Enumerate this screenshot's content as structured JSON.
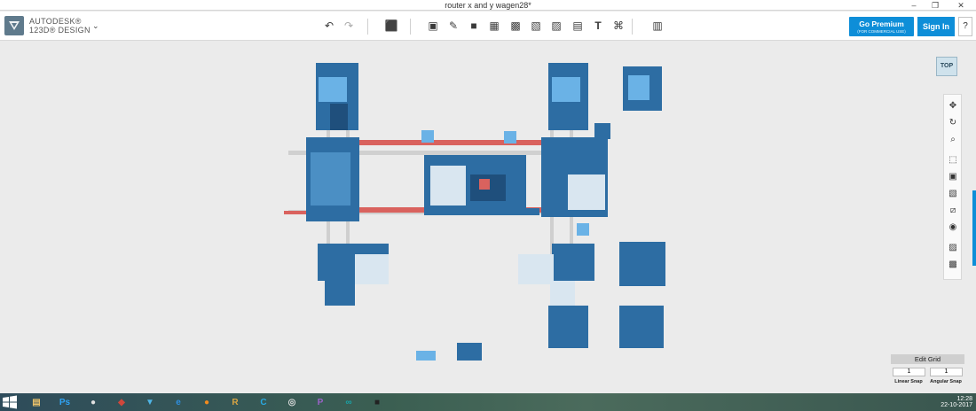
{
  "window": {
    "title": "router x and y wagen28*",
    "minimize": "–",
    "maximize": "❐",
    "close": "✕"
  },
  "brand": {
    "line1": "AUTODESK®",
    "line2": "123D® DESIGN",
    "menu_chevron": "⌄"
  },
  "toolbar": {
    "undo": "↶",
    "redo": "↷",
    "tools": [
      {
        "name": "transform-tool-icon",
        "glyph": "⬛"
      },
      {
        "name": "primitives-tool-icon",
        "glyph": "▣"
      },
      {
        "name": "sketch-tool-icon",
        "glyph": "✎"
      },
      {
        "name": "construct-tool-icon",
        "glyph": "■"
      },
      {
        "name": "modify-tool-icon",
        "glyph": "▦"
      },
      {
        "name": "pattern-tool-icon",
        "glyph": "▩"
      },
      {
        "name": "group-tool-icon",
        "glyph": "▧"
      },
      {
        "name": "combine-tool-icon",
        "glyph": "▨"
      },
      {
        "name": "measure-tool-icon",
        "glyph": "▤"
      },
      {
        "name": "text-tool-icon",
        "glyph": "T"
      },
      {
        "name": "snap-tool-icon",
        "glyph": "⌘"
      },
      {
        "name": "material-tool-icon",
        "glyph": "▥"
      }
    ],
    "premium_label": "Go Premium",
    "premium_sub": "(FOR COMMERCIAL USE)",
    "signin_label": "Sign In",
    "help_label": "?"
  },
  "viewport": {
    "viewcube_label": "TOP",
    "nav_tools": [
      {
        "name": "pan-icon",
        "glyph": "✥"
      },
      {
        "name": "orbit-icon",
        "glyph": "↻"
      },
      {
        "name": "zoom-icon",
        "glyph": "⌕"
      },
      {
        "name": "fit-icon",
        "glyph": "⬚"
      },
      {
        "name": "view-cube-icon",
        "glyph": "▣"
      },
      {
        "name": "shaded-view-icon",
        "glyph": "▧"
      },
      {
        "name": "hide-show-icon",
        "glyph": "⧄"
      },
      {
        "name": "screenshot-icon",
        "glyph": "◉"
      },
      {
        "name": "material-view-icon",
        "glyph": "▨"
      },
      {
        "name": "solid-view-icon",
        "glyph": "▩"
      }
    ],
    "grid": {
      "title": "Edit Grid",
      "linear_value": "1",
      "angular_value": "1",
      "linear_label": "Linear Snap",
      "angular_label": "Angular Snap"
    }
  },
  "taskbar": {
    "items": [
      {
        "name": "file-explorer-icon",
        "glyph": "▤",
        "color": "#e9c16a"
      },
      {
        "name": "photoshop-icon",
        "glyph": "Ps",
        "color": "#2fa3f5"
      },
      {
        "name": "media-icon",
        "glyph": "●",
        "color": "#e0e0e0"
      },
      {
        "name": "app-red-icon",
        "glyph": "◆",
        "color": "#d0473b"
      },
      {
        "name": "123d-design-icon",
        "glyph": "▼",
        "color": "#4fb5e6"
      },
      {
        "name": "internet-explorer-icon",
        "glyph": "e",
        "color": "#2e8fe0"
      },
      {
        "name": "firefox-icon",
        "glyph": "●",
        "color": "#f28b1e"
      },
      {
        "name": "app-r-icon",
        "glyph": "R",
        "color": "#d9a544"
      },
      {
        "name": "cura-icon",
        "glyph": "C",
        "color": "#29a9e1"
      },
      {
        "name": "app-swirl-icon",
        "glyph": "◎",
        "color": "#dddddd"
      },
      {
        "name": "picasa-icon",
        "glyph": "P",
        "color": "#9a62c9"
      },
      {
        "name": "arduino-icon",
        "glyph": "∞",
        "color": "#19a4a8"
      },
      {
        "name": "terminal-icon",
        "glyph": "■",
        "color": "#222222"
      }
    ],
    "time": "12:28",
    "date": "22-10-2017"
  },
  "colors": {
    "part_blue": "#2d6da3",
    "part_light": "#6ab2e6",
    "rod_red": "#d9625e",
    "accent": "#0e8ed8"
  }
}
